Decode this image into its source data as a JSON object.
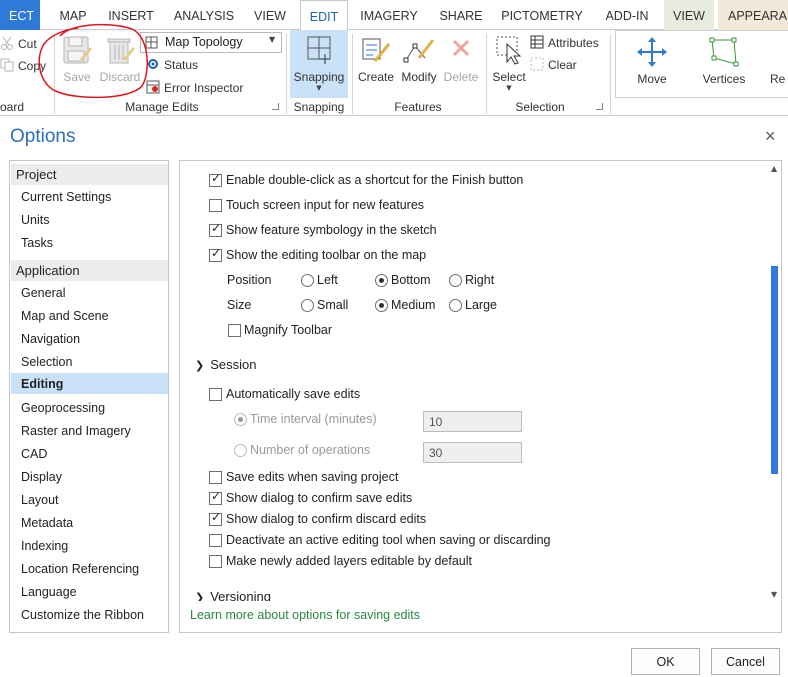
{
  "ribbon": {
    "tabs": [
      {
        "label": "ECT"
      },
      {
        "label": "MAP"
      },
      {
        "label": "INSERT"
      },
      {
        "label": "ANALYSIS"
      },
      {
        "label": "VIEW"
      },
      {
        "label": "EDIT"
      },
      {
        "label": "IMAGERY"
      },
      {
        "label": "SHARE"
      },
      {
        "label": "PICTOMETRY"
      },
      {
        "label": "ADD-IN"
      },
      {
        "label": "VIEW"
      },
      {
        "label": "APPEARAN"
      }
    ],
    "clipboard": {
      "cut": "Cut",
      "copy": "Copy",
      "group": "oard"
    },
    "manage_edits": {
      "save": "Save",
      "discard": "Discard",
      "dropdown_value": "Map Topology",
      "status": "Status",
      "error_inspector": "Error Inspector",
      "group": "Manage Edits"
    },
    "snapping": {
      "label": "Snapping",
      "group": "Snapping"
    },
    "features": {
      "create": "Create",
      "modify": "Modify",
      "delete": "Delete",
      "group": "Features"
    },
    "selection": {
      "select": "Select",
      "attributes": "Attributes",
      "clear": "Clear",
      "group": "Selection"
    },
    "tools": {
      "move": "Move",
      "vertices": "Vertices",
      "reshape": "Re"
    }
  },
  "dialog": {
    "title": "Options",
    "close": "×",
    "nav": {
      "project_header": "Project",
      "project_items": [
        "Current Settings",
        "Units",
        "Tasks"
      ],
      "application_header": "Application",
      "application_items": [
        "General",
        "Map and Scene",
        "Navigation",
        "Selection",
        "Editing",
        "Geoprocessing",
        "Raster and Imagery",
        "CAD",
        "Display",
        "Layout",
        "Metadata",
        "Indexing",
        "Location Referencing",
        "Language",
        "Customize the Ribbon"
      ],
      "selected": "Editing"
    },
    "editing": {
      "double_click": {
        "label": "Enable double-click as a shortcut for the Finish button",
        "checked": true
      },
      "touch_screen": {
        "label": "Touch screen input for new features",
        "checked": false
      },
      "feature_symbology": {
        "label": "Show feature symbology in the sketch",
        "checked": true
      },
      "editing_toolbar": {
        "label": "Show the editing toolbar on the map",
        "checked": true
      },
      "position": {
        "label": "Position",
        "options": [
          "Left",
          "Bottom",
          "Right"
        ],
        "selected": "Bottom"
      },
      "size": {
        "label": "Size",
        "options": [
          "Small",
          "Medium",
          "Large"
        ],
        "selected": "Medium"
      },
      "magnify_toolbar": {
        "label": "Magnify Toolbar",
        "checked": false
      }
    },
    "session": {
      "header": "Session",
      "auto_save": {
        "label": "Automatically save edits",
        "checked": false
      },
      "time_interval": {
        "label": "Time interval (minutes)",
        "value": "10",
        "selected": true
      },
      "num_operations": {
        "label": "Number of operations",
        "value": "30",
        "selected": false
      },
      "save_when_saving_project": {
        "label": "Save edits when saving project",
        "checked": false
      },
      "confirm_save": {
        "label": "Show dialog to confirm save edits",
        "checked": true
      },
      "confirm_discard": {
        "label": "Show dialog to confirm discard edits",
        "checked": true
      },
      "deactivate_tool": {
        "label": "Deactivate an active editing tool when saving or discarding",
        "checked": false
      },
      "make_editable": {
        "label": "Make newly added layers editable by default",
        "checked": false
      }
    },
    "versioning_header": "Versioning",
    "learn_more": "Learn more about options for saving edits",
    "ok": "OK",
    "cancel": "Cancel"
  },
  "colors": {
    "accent": "#2f7ad8",
    "selection": "#c9e2f7",
    "annotation": "#e0141e",
    "link": "#2a8a3c"
  }
}
